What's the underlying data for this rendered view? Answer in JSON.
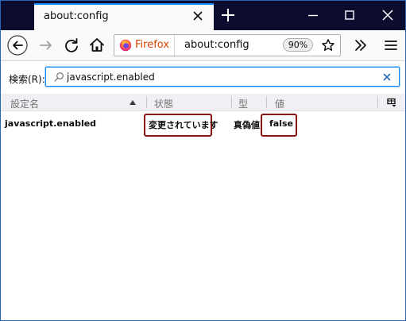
{
  "tab": {
    "title": "about:config"
  },
  "window_controls": {
    "minimize_icon": "minimize-icon",
    "maximize_icon": "maximize-icon",
    "close_icon": "close-icon"
  },
  "navbar": {
    "identity_label": "Firefox",
    "url": "about:config",
    "zoom": "90%"
  },
  "config": {
    "search_label": "検索(R):",
    "search_value": "javascript.enabled",
    "columns": {
      "name": "設定名",
      "status": "状態",
      "type": "型",
      "value": "値"
    },
    "rows": [
      {
        "name": "javascript.enabled",
        "status": "変更されています",
        "type": "真偽値",
        "value": "false"
      }
    ]
  },
  "colors": {
    "titlebar": "#0c0c2e",
    "accent": "#0a84ff",
    "highlight": "#8b1414",
    "firefox_label": "#d74300"
  }
}
